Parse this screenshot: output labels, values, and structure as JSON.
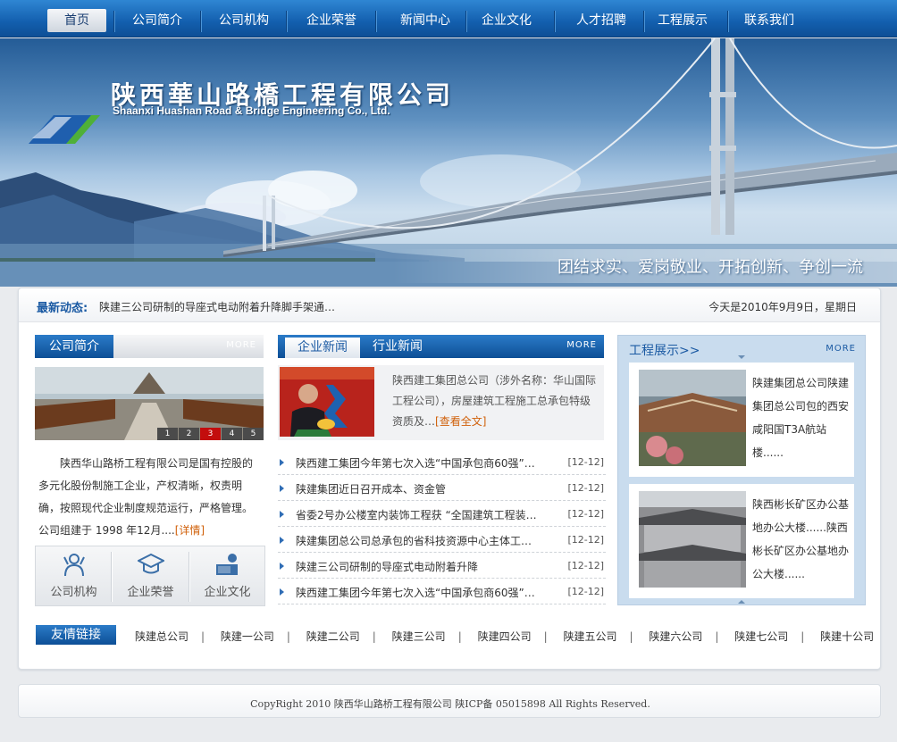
{
  "nav": {
    "items": [
      {
        "label": "首页",
        "active": true
      },
      {
        "label": "公司简介"
      },
      {
        "label": "公司机构"
      },
      {
        "label": "企业荣誉"
      },
      {
        "label": "新闻中心"
      },
      {
        "label": "企业文化"
      },
      {
        "label": "人才招聘"
      },
      {
        "label": "工程展示"
      },
      {
        "label": "联系我们"
      }
    ]
  },
  "banner": {
    "company_cn": "陕西華山路橋工程有限公司",
    "company_en": "Shaanxi Huashan Road & Bridge Engineering Co., Ltd.",
    "slogan": "团结求实、爱岗敬业、开拓创新、争创一流"
  },
  "newsbar": {
    "label": "最新动态:",
    "text": "陕建三公司研制的导座式电动附着升降脚手架通…",
    "date": "今天是2010年9月9日，星期日"
  },
  "intro": {
    "tab": "公司简介",
    "more": "MORE",
    "pager": [
      "1",
      "2",
      "3",
      "4",
      "5"
    ],
    "pager_active": 3,
    "text": "陕西华山路桥工程有限公司是国有控股的多元化股份制施工企业，产权清晰，权责明确，按照现代企业制度规范运行，严格管理。公司组建于 1998 年12月....",
    "detail_link": "[详情]",
    "icons": [
      {
        "label": "公司机构",
        "icon": "person-icon"
      },
      {
        "label": "企业荣誉",
        "icon": "graduation-cap-icon"
      },
      {
        "label": "企业文化",
        "icon": "presenter-icon"
      }
    ]
  },
  "news": {
    "tab_active": "企业新闻",
    "tab_other": "行业新闻",
    "more": "MORE",
    "feature_text": "陕西建工集团总公司（涉外名称：华山国际工程公司），房屋建筑工程施工总承包特级资质及…",
    "feature_link": "[查看全文]",
    "items": [
      {
        "title": "陕西建工集团今年第七次入选“中国承包商60强”…",
        "date": "[12-12]"
      },
      {
        "title": "陕建集团近日召开成本、资金管",
        "date": "[12-12]"
      },
      {
        "title": "省委2号办公楼室内装饰工程获 “全国建筑工程装…",
        "date": "[12-12]"
      },
      {
        "title": "陕建集团总公司总承包的省科技资源中心主体工…",
        "date": "[12-12]"
      },
      {
        "title": "陕建三公司研制的导座式电动附着升降",
        "date": "[12-12]"
      },
      {
        "title": "陕西建工集团今年第七次入选“中国承包商60强”…",
        "date": "[12-12]"
      }
    ]
  },
  "projects": {
    "title": "工程展示>>",
    "more": "MORE",
    "cards": [
      {
        "text": "陕建集团总公司陕建集团总公司包的西安咸阳国T3A航站楼......"
      },
      {
        "text": "陕西彬长矿区办公基地办公大楼......陕西彬长矿区办公基地办公大楼......"
      }
    ]
  },
  "links": {
    "tab": "友情链接",
    "items": [
      "陕建总公司",
      "陕建一公司",
      "陕建二公司",
      "陕建三公司",
      "陕建四公司",
      "陕建五公司",
      "陕建六公司",
      "陕建七公司",
      "陕建十公司"
    ]
  },
  "footer": {
    "text": "CopyRight 2010  陕西华山路桥工程有限公司  陕ICP备 05015898 All Rights Reserved."
  },
  "colors": {
    "nav_blue": "#135fae",
    "accent_orange": "#d0600a",
    "pager_active": "#c30d0d",
    "project_panel": "#c9dcee"
  }
}
